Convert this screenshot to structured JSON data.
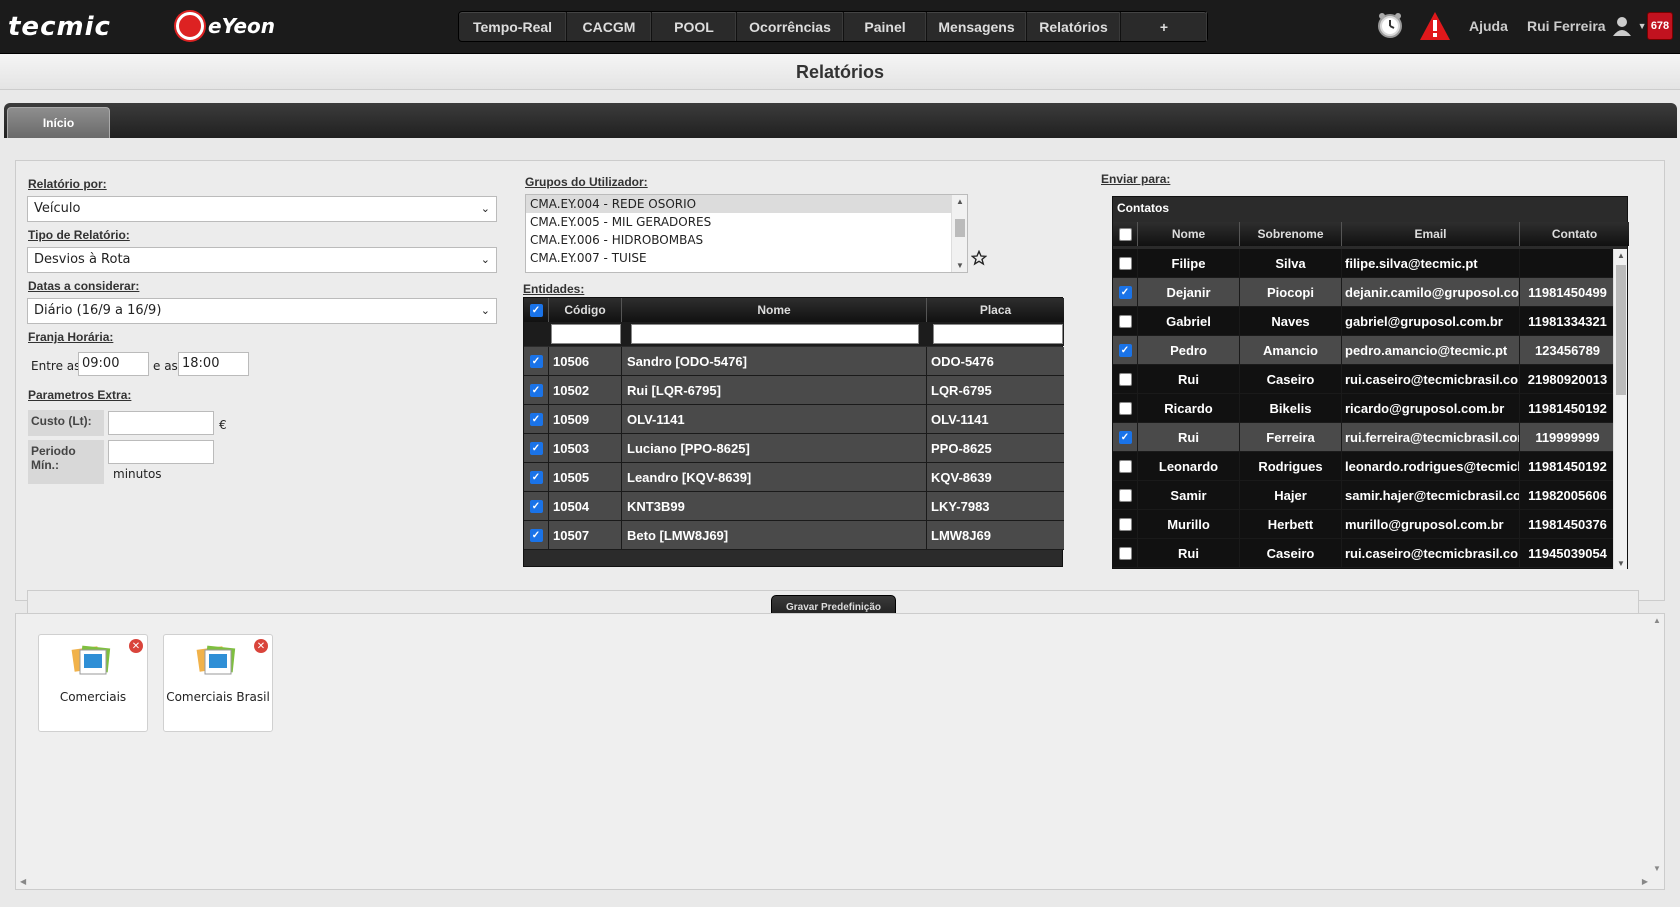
{
  "header": {
    "brand": "tecmic",
    "subbrand": "eYeon",
    "nav": [
      "Tempo-Real",
      "CACGM",
      "POOL",
      "Ocorrências",
      "Painel",
      "Mensagens",
      "Relatórios",
      "+"
    ],
    "help": "Ajuda",
    "user": "Rui Ferreira",
    "badge": "678"
  },
  "page_title": "Relatórios",
  "tabs": [
    {
      "label": "Início"
    }
  ],
  "form": {
    "report_by_label": "Relatório por:",
    "report_by_value": "Veículo",
    "report_type_label": "Tipo de Relatório:",
    "report_type_value": "Desvios à Rota",
    "dates_label": "Datas a considerar:",
    "dates_value": "Diário (16/9 a 16/9)",
    "time_range_label": "Franja Horária:",
    "between_label": "Entre as",
    "from_time": "09:00",
    "and_label": "e as",
    "to_time": "18:00",
    "extra_label": "Parametros Extra:",
    "cost_label": "Custo (Lt):",
    "cost_unit": "€",
    "period_label": "Periodo Mín.:",
    "period_unit": "minutos"
  },
  "groups": {
    "label": "Grupos do Utilizador:",
    "items": [
      {
        "name": "CMA.EY.004 - REDE OSORIO",
        "selected": true
      },
      {
        "name": "CMA.EY.005 - MIL GERADORES",
        "selected": false
      },
      {
        "name": "CMA.EY.006 - HIDROBOMBAS",
        "selected": false
      },
      {
        "name": "CMA.EY.007 - TUISE",
        "selected": false
      }
    ]
  },
  "entities": {
    "label": "Entidades:",
    "columns": [
      "Código",
      "Nome",
      "Placa"
    ],
    "rows": [
      {
        "code": "10506",
        "name": "Sandro [ODO-5476]",
        "plate": "ODO-5476",
        "checked": true
      },
      {
        "code": "10502",
        "name": "Rui [LQR-6795]",
        "plate": "LQR-6795",
        "checked": true
      },
      {
        "code": "10509",
        "name": "OLV-1141",
        "plate": "OLV-1141",
        "checked": true
      },
      {
        "code": "10503",
        "name": "Luciano [PPO-8625]",
        "plate": "PPO-8625",
        "checked": true
      },
      {
        "code": "10505",
        "name": "Leandro [KQV-8639]",
        "plate": "KQV-8639",
        "checked": true
      },
      {
        "code": "10504",
        "name": "KNT3B99",
        "plate": "LKY-7983",
        "checked": true
      },
      {
        "code": "10507",
        "name": "Beto [LMW8J69]",
        "plate": "LMW8J69",
        "checked": true
      }
    ]
  },
  "contacts": {
    "label": "Enviar para:",
    "title": "Contatos",
    "columns": [
      "Nome",
      "Sobrenome",
      "Email",
      "Contato"
    ],
    "rows": [
      {
        "first": "Filipe",
        "last": "Silva",
        "email": "filipe.silva@tecmic.pt",
        "phone": "",
        "checked": false
      },
      {
        "first": "Dejanir",
        "last": "Piocopi",
        "email": "dejanir.camilo@gruposol.com",
        "phone": "11981450499",
        "checked": true
      },
      {
        "first": "Gabriel",
        "last": "Naves",
        "email": "gabriel@gruposol.com.br",
        "phone": "11981334321",
        "checked": false
      },
      {
        "first": "Pedro",
        "last": "Amancio",
        "email": "pedro.amancio@tecmic.pt",
        "phone": "123456789",
        "checked": true
      },
      {
        "first": "Rui",
        "last": "Caseiro",
        "email": "rui.caseiro@tecmicbrasil.com",
        "phone": "21980920013",
        "checked": false
      },
      {
        "first": "Ricardo",
        "last": "Bikelis",
        "email": "ricardo@gruposol.com.br",
        "phone": "11981450192",
        "checked": false
      },
      {
        "first": "Rui",
        "last": "Ferreira",
        "email": "rui.ferreira@tecmicbrasil.com",
        "phone": "119999999",
        "checked": true
      },
      {
        "first": "Leonardo",
        "last": "Rodrigues",
        "email": "leonardo.rodrigues@tecmicbrasil.com",
        "phone": "11981450192",
        "checked": false
      },
      {
        "first": "Samir",
        "last": "Hajer",
        "email": "samir.hajer@tecmicbrasil.com",
        "phone": "11982005606",
        "checked": false
      },
      {
        "first": "Murillo",
        "last": "Herbett",
        "email": "murillo@gruposol.com.br",
        "phone": "11981450376",
        "checked": false
      },
      {
        "first": "Rui",
        "last": "Caseiro",
        "email": "rui.caseiro@tecmicbrasil.com",
        "phone": "11945039054",
        "checked": false
      }
    ]
  },
  "save_button": "Gravar Predefinição",
  "presets": [
    {
      "name": "Comerciais"
    },
    {
      "name": "Comerciais Brasil"
    }
  ],
  "colors": {
    "accent": "#1a73e8",
    "alert": "#c1121f"
  }
}
